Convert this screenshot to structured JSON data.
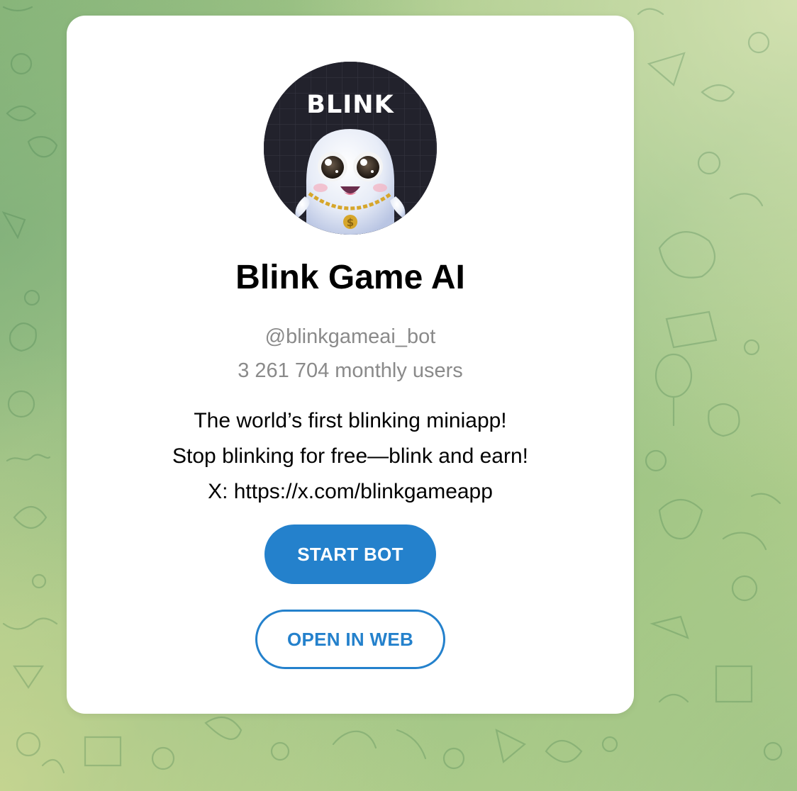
{
  "bot": {
    "avatar_text": "BLINK",
    "name": "Blink Game AI",
    "username": "@blinkgameai_bot",
    "monthly_users": "3 261 704 monthly users",
    "description_lines": [
      "The world’s first blinking miniapp!",
      "Stop blinking for free—blink and earn!",
      "X: https://x.com/blinkgameapp"
    ]
  },
  "actions": {
    "start_label": "START BOT",
    "open_web_label": "OPEN IN WEB"
  },
  "colors": {
    "accent": "#2481cc",
    "background": "#9cc486",
    "card": "#ffffff",
    "muted_text": "#8a8a8a"
  },
  "icons": {
    "avatar": "ghost-mascot-icon",
    "background_pattern": "doodle-pattern-icon"
  }
}
